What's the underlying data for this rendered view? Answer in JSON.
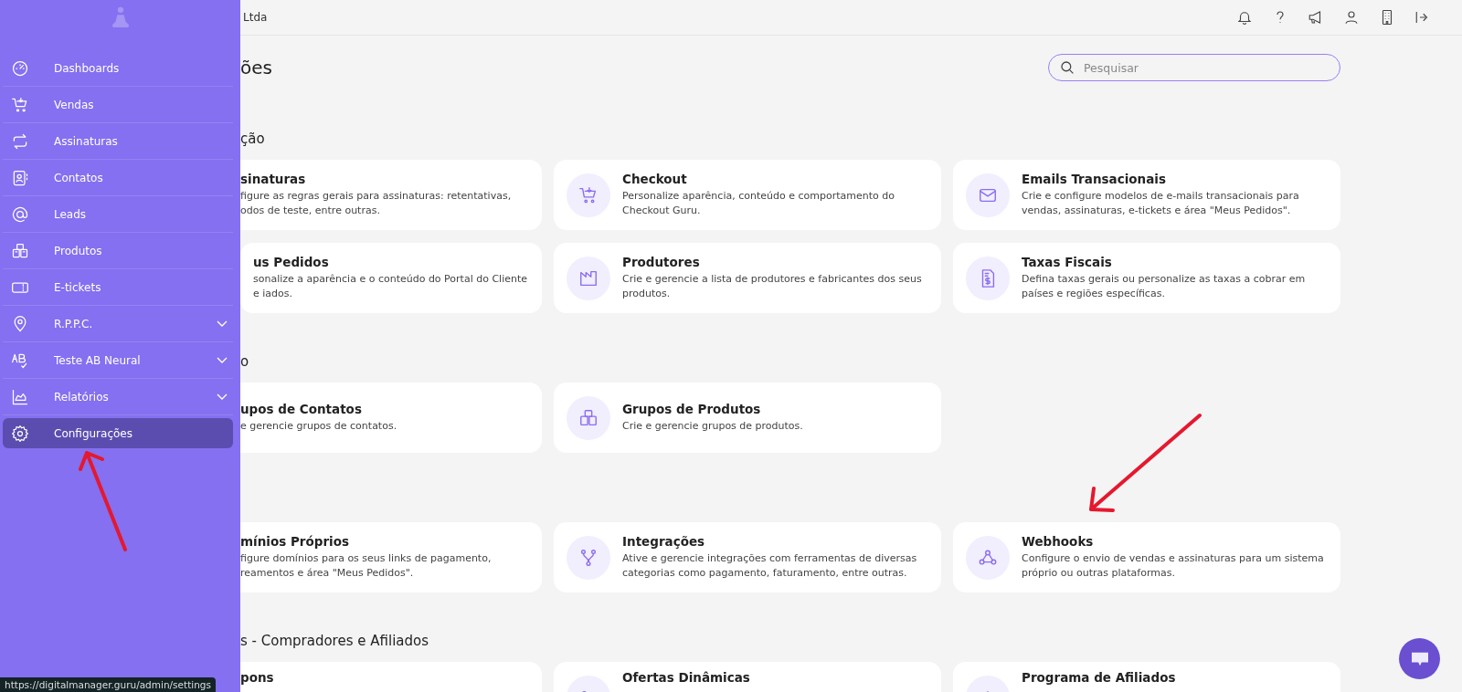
{
  "sidebar": {
    "items": [
      {
        "label": "Dashboards",
        "expandable": false,
        "selected": false
      },
      {
        "label": "Vendas",
        "expandable": false,
        "selected": false
      },
      {
        "label": "Assinaturas",
        "expandable": false,
        "selected": false
      },
      {
        "label": "Contatos",
        "expandable": false,
        "selected": false
      },
      {
        "label": "Leads",
        "expandable": false,
        "selected": false
      },
      {
        "label": "Produtos",
        "expandable": false,
        "selected": false
      },
      {
        "label": "E-tickets",
        "expandable": false,
        "selected": false
      },
      {
        "label": "R.P.P.C.",
        "expandable": true,
        "selected": false
      },
      {
        "label": "Teste AB Neural",
        "expandable": true,
        "selected": false
      },
      {
        "label": "Relatórios",
        "expandable": true,
        "selected": false
      },
      {
        "label": "Configurações",
        "expandable": false,
        "selected": true
      }
    ]
  },
  "top_bar": {
    "company": "Ltda"
  },
  "page_title": "ões",
  "search": {
    "placeholder": "Pesquisar"
  },
  "sections": [
    {
      "title": "ção",
      "cards": [
        {
          "title": "sinaturas",
          "description": "figure as regras gerais para assinaturas: retentativas, odos de teste, entre outras."
        },
        {
          "title": "Checkout",
          "description": "Personalize aparência, conteúdo e comportamento do Checkout Guru."
        },
        {
          "title": "Emails Transacionais",
          "description": "Crie e configure modelos de e-mails transacionais para vendas, assinaturas, e-tickets e área \"Meus Pedidos\"."
        },
        {
          "title": "us Pedidos",
          "description": "sonalize a aparência e o conteúdo do Portal do Cliente e iados."
        },
        {
          "title": "Produtores",
          "description": "Crie e gerencie a lista de produtores e fabricantes dos seus produtos."
        },
        {
          "title": "Taxas Fiscais",
          "description": "Defina taxas gerais ou personalize as taxas a cobrar em países e regiões específicas."
        }
      ]
    },
    {
      "title": "o",
      "cards": [
        {
          "title": "upos de Contatos",
          "description": "e gerencie grupos de contatos."
        },
        {
          "title": "Grupos de Produtos",
          "description": "Crie e gerencie grupos de produtos."
        }
      ]
    },
    {
      "cards": [
        {
          "title": "mínios Próprios",
          "description": "figure domínios para os seus links de pagamento, reamentos e área \"Meus Pedidos\"."
        },
        {
          "title": "Integrações",
          "description": "Ative e gerencie integrações com ferramentas de diversas categorias como pagamento, faturamento, entre outras."
        },
        {
          "title": "Webhooks",
          "description": "Configure o envio de vendas e assinaturas para um sistema próprio ou outras plataformas."
        }
      ]
    },
    {
      "title": "s - Compradores e Afiliados",
      "cards": [
        {
          "title": "pons"
        },
        {
          "title": "Ofertas Dinâmicas"
        },
        {
          "title": "Programa de Afiliados"
        }
      ]
    }
  ],
  "status_url": "https://digitalmanager.guru/admin/settings"
}
